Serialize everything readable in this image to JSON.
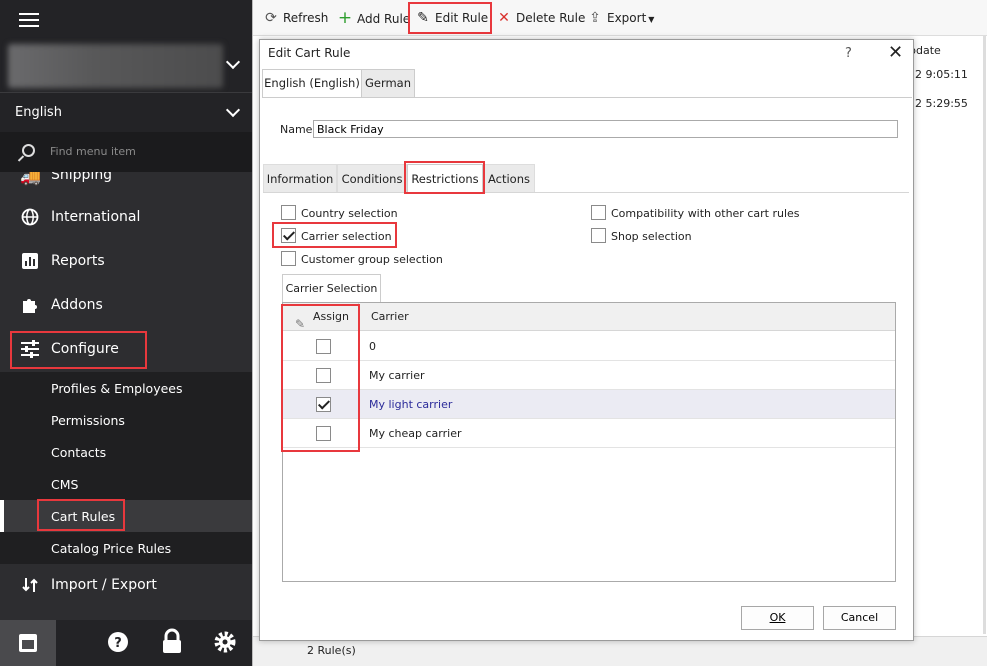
{
  "sidebar": {
    "language": "English",
    "search_placeholder": "Find menu item",
    "items": [
      {
        "label": "Shipping",
        "icon": "truck-icon"
      },
      {
        "label": "International",
        "icon": "globe-icon"
      },
      {
        "label": "Reports",
        "icon": "bar-chart-icon"
      },
      {
        "label": "Addons",
        "icon": "puzzle-icon"
      },
      {
        "label": "Configure",
        "icon": "sliders-icon"
      },
      {
        "label": "Import / Export",
        "icon": "import-export-icon"
      }
    ],
    "sub_items": [
      "Profiles & Employees",
      "Permissions",
      "Contacts",
      "CMS",
      "Cart Rules",
      "Catalog Price Rules"
    ],
    "bottom_icons": [
      "store-icon",
      "help-icon",
      "lock-icon",
      "gear-icon"
    ]
  },
  "toolbar": {
    "refresh": "Refresh",
    "add_rule": "Add Rule",
    "edit_rule": "Edit Rule",
    "delete_rule": "Delete Rule",
    "export": "Export"
  },
  "grid": {
    "header_fragment": "pdate",
    "rows": [
      "2 9:05:11",
      "2 5:29:55"
    ]
  },
  "status": "2 Rule(s)",
  "dialog": {
    "title": "Edit Cart Rule",
    "help": "?",
    "close": "✕",
    "lang_tabs": [
      "English (English)",
      "German"
    ],
    "name_label": "Name",
    "name_value": "Black Friday",
    "tabs": [
      "Information",
      "Conditions",
      "Restrictions",
      "Actions"
    ],
    "options": {
      "country_selection": "Country selection",
      "carrier_selection": "Carrier selection",
      "customer_group_selection": "Customer group selection",
      "compatibility": "Compatibility with other cart rules",
      "shop_selection": "Shop selection"
    },
    "carrier_tab": "Carrier Selection",
    "columns": {
      "assign": "Assign",
      "carrier": "Carrier"
    },
    "carriers": [
      {
        "name": "0",
        "checked": false
      },
      {
        "name": "My carrier",
        "checked": false
      },
      {
        "name": "My light carrier",
        "checked": true
      },
      {
        "name": "My cheap carrier",
        "checked": false
      }
    ],
    "ok": "OK",
    "cancel": "Cancel"
  }
}
